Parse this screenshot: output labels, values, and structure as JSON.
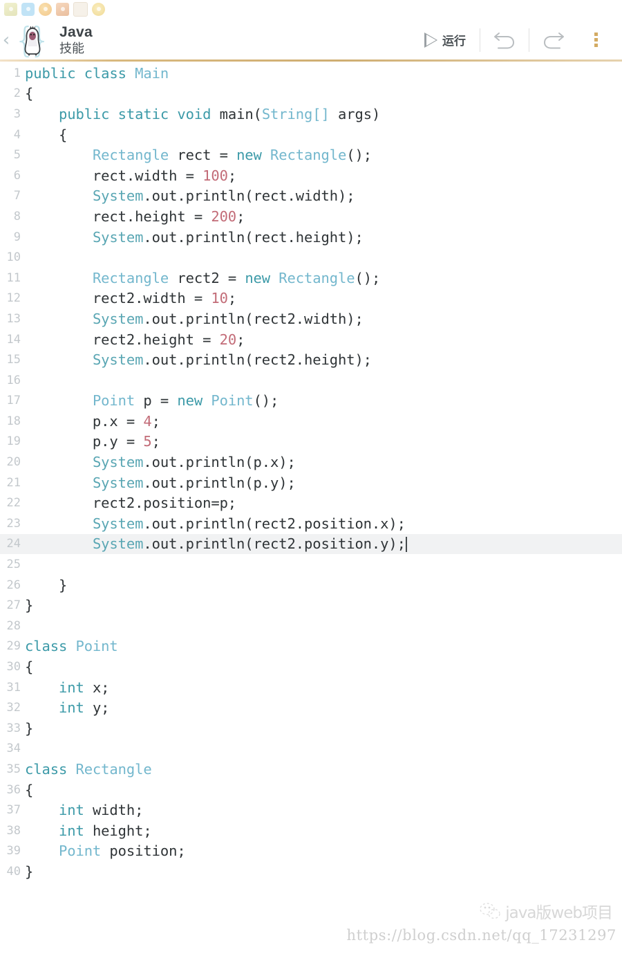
{
  "statusbar": {
    "icons": [
      {
        "name": "app-icon-1"
      },
      {
        "name": "app-icon-2"
      },
      {
        "name": "app-icon-3"
      },
      {
        "name": "app-icon-4"
      },
      {
        "name": "app-icon-5"
      },
      {
        "name": "app-icon-6"
      }
    ]
  },
  "header": {
    "back_label": "‹",
    "title": "Java",
    "subtitle": "技能",
    "logo_icon": "java-penguin-braces-icon"
  },
  "toolbar": {
    "run_label": "运行",
    "run_icon": "play-triangle-icon",
    "undo_icon": "undo-arrow-icon",
    "redo_icon": "redo-arrow-icon",
    "more_icon": "more-vertical-dots-icon"
  },
  "editor": {
    "active_line": 24,
    "cursor_line": 24,
    "colors": {
      "keyword": "#3c9aa8",
      "type": "#73b7cd",
      "number": "#c26b77",
      "plain": "#2f3437",
      "gutter": "#c3c8cc",
      "active_line_bg": "#f1f2f3",
      "accent": "#d3ab63"
    },
    "lines": [
      {
        "n": 1,
        "tokens": [
          {
            "t": "public ",
            "c": "kw"
          },
          {
            "t": "class ",
            "c": "kw"
          },
          {
            "t": "Main",
            "c": "typ"
          }
        ]
      },
      {
        "n": 2,
        "tokens": [
          {
            "t": "{",
            "c": "pl"
          }
        ]
      },
      {
        "n": 3,
        "tokens": [
          {
            "t": "    ",
            "c": "pl"
          },
          {
            "t": "public ",
            "c": "kw"
          },
          {
            "t": "static ",
            "c": "kw"
          },
          {
            "t": "void ",
            "c": "kw"
          },
          {
            "t": "main(",
            "c": "pl"
          },
          {
            "t": "String[]",
            "c": "typ"
          },
          {
            "t": " args)",
            "c": "pl"
          }
        ]
      },
      {
        "n": 4,
        "tokens": [
          {
            "t": "    {",
            "c": "pl"
          }
        ]
      },
      {
        "n": 5,
        "tokens": [
          {
            "t": "        ",
            "c": "pl"
          },
          {
            "t": "Rectangle",
            "c": "typ"
          },
          {
            "t": " rect = ",
            "c": "pl"
          },
          {
            "t": "new ",
            "c": "kw"
          },
          {
            "t": "Rectangle",
            "c": "typ"
          },
          {
            "t": "();",
            "c": "pl"
          }
        ]
      },
      {
        "n": 6,
        "tokens": [
          {
            "t": "        rect.width = ",
            "c": "pl"
          },
          {
            "t": "100",
            "c": "num"
          },
          {
            "t": ";",
            "c": "pl"
          }
        ]
      },
      {
        "n": 7,
        "tokens": [
          {
            "t": "        ",
            "c": "pl"
          },
          {
            "t": "System",
            "c": "sys"
          },
          {
            "t": ".out.println(rect.width);",
            "c": "pl"
          }
        ]
      },
      {
        "n": 8,
        "tokens": [
          {
            "t": "        rect.height = ",
            "c": "pl"
          },
          {
            "t": "200",
            "c": "num"
          },
          {
            "t": ";",
            "c": "pl"
          }
        ]
      },
      {
        "n": 9,
        "tokens": [
          {
            "t": "        ",
            "c": "pl"
          },
          {
            "t": "System",
            "c": "sys"
          },
          {
            "t": ".out.println(rect.height);",
            "c": "pl"
          }
        ]
      },
      {
        "n": 10,
        "tokens": []
      },
      {
        "n": 11,
        "tokens": [
          {
            "t": "        ",
            "c": "pl"
          },
          {
            "t": "Rectangle",
            "c": "typ"
          },
          {
            "t": " rect2 = ",
            "c": "pl"
          },
          {
            "t": "new ",
            "c": "kw"
          },
          {
            "t": "Rectangle",
            "c": "typ"
          },
          {
            "t": "();",
            "c": "pl"
          }
        ]
      },
      {
        "n": 12,
        "tokens": [
          {
            "t": "        rect2.width = ",
            "c": "pl"
          },
          {
            "t": "10",
            "c": "num"
          },
          {
            "t": ";",
            "c": "pl"
          }
        ]
      },
      {
        "n": 13,
        "tokens": [
          {
            "t": "        ",
            "c": "pl"
          },
          {
            "t": "System",
            "c": "sys"
          },
          {
            "t": ".out.println(rect2.width);",
            "c": "pl"
          }
        ]
      },
      {
        "n": 14,
        "tokens": [
          {
            "t": "        rect2.height = ",
            "c": "pl"
          },
          {
            "t": "20",
            "c": "num"
          },
          {
            "t": ";",
            "c": "pl"
          }
        ]
      },
      {
        "n": 15,
        "tokens": [
          {
            "t": "        ",
            "c": "pl"
          },
          {
            "t": "System",
            "c": "sys"
          },
          {
            "t": ".out.println(rect2.height);",
            "c": "pl"
          }
        ]
      },
      {
        "n": 16,
        "tokens": []
      },
      {
        "n": 17,
        "tokens": [
          {
            "t": "        ",
            "c": "pl"
          },
          {
            "t": "Point",
            "c": "typ"
          },
          {
            "t": " p = ",
            "c": "pl"
          },
          {
            "t": "new ",
            "c": "kw"
          },
          {
            "t": "Point",
            "c": "typ"
          },
          {
            "t": "();",
            "c": "pl"
          }
        ]
      },
      {
        "n": 18,
        "tokens": [
          {
            "t": "        p.x = ",
            "c": "pl"
          },
          {
            "t": "4",
            "c": "num"
          },
          {
            "t": ";",
            "c": "pl"
          }
        ]
      },
      {
        "n": 19,
        "tokens": [
          {
            "t": "        p.y = ",
            "c": "pl"
          },
          {
            "t": "5",
            "c": "num"
          },
          {
            "t": ";",
            "c": "pl"
          }
        ]
      },
      {
        "n": 20,
        "tokens": [
          {
            "t": "        ",
            "c": "pl"
          },
          {
            "t": "System",
            "c": "sys"
          },
          {
            "t": ".out.println(p.x);",
            "c": "pl"
          }
        ]
      },
      {
        "n": 21,
        "tokens": [
          {
            "t": "        ",
            "c": "pl"
          },
          {
            "t": "System",
            "c": "sys"
          },
          {
            "t": ".out.println(p.y);",
            "c": "pl"
          }
        ]
      },
      {
        "n": 22,
        "tokens": [
          {
            "t": "        rect2.position=p;",
            "c": "pl"
          }
        ]
      },
      {
        "n": 23,
        "tokens": [
          {
            "t": "        ",
            "c": "pl"
          },
          {
            "t": "System",
            "c": "sys"
          },
          {
            "t": ".out.println(rect2.position.x);",
            "c": "pl"
          }
        ]
      },
      {
        "n": 24,
        "tokens": [
          {
            "t": "        ",
            "c": "pl"
          },
          {
            "t": "System",
            "c": "sys"
          },
          {
            "t": ".out.println(rect2.position.y);",
            "c": "pl"
          }
        ],
        "caret": true
      },
      {
        "n": 25,
        "tokens": []
      },
      {
        "n": 26,
        "tokens": [
          {
            "t": "    }",
            "c": "pl"
          }
        ]
      },
      {
        "n": 27,
        "tokens": [
          {
            "t": "}",
            "c": "pl"
          }
        ]
      },
      {
        "n": 28,
        "tokens": []
      },
      {
        "n": 29,
        "tokens": [
          {
            "t": "class ",
            "c": "kw"
          },
          {
            "t": "Point",
            "c": "typ"
          }
        ]
      },
      {
        "n": 30,
        "tokens": [
          {
            "t": "{",
            "c": "pl"
          }
        ]
      },
      {
        "n": 31,
        "tokens": [
          {
            "t": "    ",
            "c": "pl"
          },
          {
            "t": "int ",
            "c": "kw"
          },
          {
            "t": "x;",
            "c": "pl"
          }
        ]
      },
      {
        "n": 32,
        "tokens": [
          {
            "t": "    ",
            "c": "pl"
          },
          {
            "t": "int ",
            "c": "kw"
          },
          {
            "t": "y;",
            "c": "pl"
          }
        ]
      },
      {
        "n": 33,
        "tokens": [
          {
            "t": "}",
            "c": "pl"
          }
        ]
      },
      {
        "n": 34,
        "tokens": []
      },
      {
        "n": 35,
        "tokens": [
          {
            "t": "class ",
            "c": "kw"
          },
          {
            "t": "Rectangle",
            "c": "typ"
          }
        ]
      },
      {
        "n": 36,
        "tokens": [
          {
            "t": "{",
            "c": "pl"
          }
        ]
      },
      {
        "n": 37,
        "tokens": [
          {
            "t": "    ",
            "c": "pl"
          },
          {
            "t": "int ",
            "c": "kw"
          },
          {
            "t": "width;",
            "c": "pl"
          }
        ]
      },
      {
        "n": 38,
        "tokens": [
          {
            "t": "    ",
            "c": "pl"
          },
          {
            "t": "int ",
            "c": "kw"
          },
          {
            "t": "height;",
            "c": "pl"
          }
        ]
      },
      {
        "n": 39,
        "tokens": [
          {
            "t": "    ",
            "c": "pl"
          },
          {
            "t": "Point",
            "c": "typ"
          },
          {
            "t": " position;",
            "c": "pl"
          }
        ]
      },
      {
        "n": 40,
        "tokens": [
          {
            "t": "}",
            "c": "pl"
          }
        ]
      }
    ]
  },
  "watermark": {
    "text": "java版web项目",
    "logo_icon": "wechat-official-account-icon",
    "url": "https://blog.csdn.net/qq_17231297"
  }
}
